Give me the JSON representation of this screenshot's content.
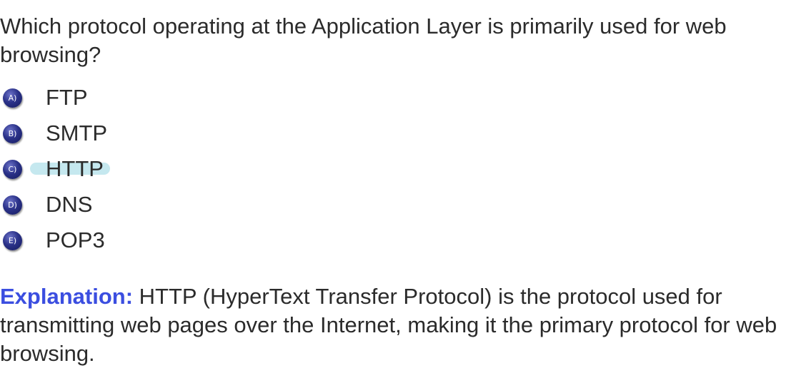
{
  "question": "Which protocol operating at the Application Layer is primarily used for web browsing?",
  "options": [
    {
      "marker": "A)",
      "text": "FTP"
    },
    {
      "marker": "B)",
      "text": "SMTP"
    },
    {
      "marker": "C)",
      "text": "HTTP"
    },
    {
      "marker": "D)",
      "text": "DNS"
    },
    {
      "marker": "E)",
      "text": "POP3"
    }
  ],
  "highlighted_option": "C)",
  "explanation": {
    "label": "Explanation:",
    "text": "HTTP (HyperText Transfer Protocol) is the protocol used for transmitting web pages over the Internet, making it the primary protocol for web browsing."
  },
  "colors": {
    "text": "#2b2b2b",
    "marker": "#2b3289",
    "highlight": "#96d6e2",
    "explanation_label": "#3b4ee0"
  }
}
